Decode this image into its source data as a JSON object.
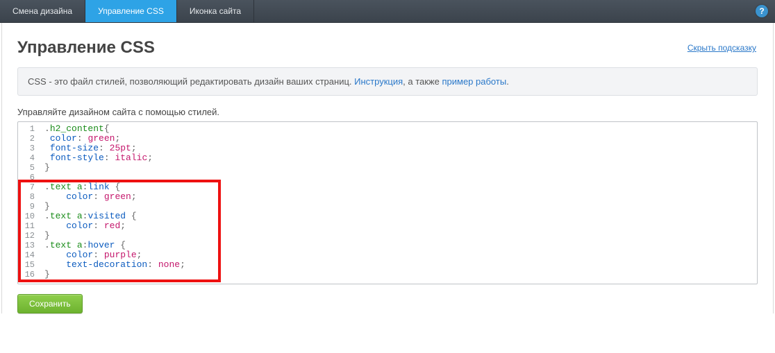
{
  "topbar": {
    "tabs": [
      {
        "label": "Смена дизайна",
        "active": false
      },
      {
        "label": "Управление CSS",
        "active": true
      },
      {
        "label": "Иконка сайта",
        "active": false
      }
    ],
    "help_glyph": "?"
  },
  "header": {
    "title": "Управление CSS",
    "hide_hint": "Скрыть подсказку"
  },
  "hint": {
    "prefix": "CSS - это файл стилей, позволяющий редактировать дизайн ваших страниц. ",
    "link1": "Инструкция",
    "mid": ", а также ",
    "link2": "пример работы",
    "suffix": "."
  },
  "subhead": "Управляйте дизайном сайта с помощью стилей.",
  "code_lines": [
    {
      "n": 1,
      "raw": ".h2_content{",
      "tokens": [
        {
          "t": "punc",
          "v": "."
        },
        {
          "t": "ident",
          "v": "h2_content"
        },
        {
          "t": "punc",
          "v": "{"
        }
      ]
    },
    {
      "n": 2,
      "raw": "color: green;",
      "indent": " ",
      "tokens": [
        {
          "t": "prop",
          "v": "color"
        },
        {
          "t": "punc",
          "v": ": "
        },
        {
          "t": "val",
          "v": "green"
        },
        {
          "t": "punc",
          "v": ";"
        }
      ]
    },
    {
      "n": 3,
      "raw": "font-size: 25pt;",
      "indent": " ",
      "tokens": [
        {
          "t": "prop",
          "v": "font-size"
        },
        {
          "t": "punc",
          "v": ": "
        },
        {
          "t": "num",
          "v": "25pt"
        },
        {
          "t": "punc",
          "v": ";"
        }
      ]
    },
    {
      "n": 4,
      "raw": "font-style: italic;",
      "indent": " ",
      "tokens": [
        {
          "t": "prop",
          "v": "font-style"
        },
        {
          "t": "punc",
          "v": ": "
        },
        {
          "t": "val",
          "v": "italic"
        },
        {
          "t": "punc",
          "v": ";"
        }
      ]
    },
    {
      "n": 5,
      "raw": "}",
      "tokens": [
        {
          "t": "punc",
          "v": "}"
        }
      ]
    },
    {
      "n": 6,
      "raw": "",
      "tokens": []
    },
    {
      "n": 7,
      "raw": ".text a:link {",
      "tokens": [
        {
          "t": "punc",
          "v": "."
        },
        {
          "t": "ident",
          "v": "text"
        },
        {
          "t": "punc",
          "v": " "
        },
        {
          "t": "sel",
          "v": "a"
        },
        {
          "t": "punc",
          "v": ":"
        },
        {
          "t": "pseudo",
          "v": "link"
        },
        {
          "t": "punc",
          "v": " {"
        }
      ]
    },
    {
      "n": 8,
      "raw": "    color: green;",
      "indent": "    ",
      "tokens": [
        {
          "t": "prop",
          "v": "color"
        },
        {
          "t": "punc",
          "v": ": "
        },
        {
          "t": "val",
          "v": "green"
        },
        {
          "t": "punc",
          "v": ";"
        }
      ]
    },
    {
      "n": 9,
      "raw": "}",
      "tokens": [
        {
          "t": "punc",
          "v": "}"
        }
      ]
    },
    {
      "n": 10,
      "raw": ".text a:visited {",
      "tokens": [
        {
          "t": "punc",
          "v": "."
        },
        {
          "t": "ident",
          "v": "text"
        },
        {
          "t": "punc",
          "v": " "
        },
        {
          "t": "sel",
          "v": "a"
        },
        {
          "t": "punc",
          "v": ":"
        },
        {
          "t": "pseudo",
          "v": "visited"
        },
        {
          "t": "punc",
          "v": " {"
        }
      ]
    },
    {
      "n": 11,
      "raw": "    color: red;",
      "indent": "    ",
      "tokens": [
        {
          "t": "prop",
          "v": "color"
        },
        {
          "t": "punc",
          "v": ": "
        },
        {
          "t": "val",
          "v": "red"
        },
        {
          "t": "punc",
          "v": ";"
        }
      ]
    },
    {
      "n": 12,
      "raw": "}",
      "tokens": [
        {
          "t": "punc",
          "v": "}"
        }
      ]
    },
    {
      "n": 13,
      "raw": ".text a:hover {",
      "tokens": [
        {
          "t": "punc",
          "v": "."
        },
        {
          "t": "ident",
          "v": "text"
        },
        {
          "t": "punc",
          "v": " "
        },
        {
          "t": "sel",
          "v": "a"
        },
        {
          "t": "punc",
          "v": ":"
        },
        {
          "t": "pseudo",
          "v": "hover"
        },
        {
          "t": "punc",
          "v": " {"
        }
      ]
    },
    {
      "n": 14,
      "raw": "    color: purple;",
      "indent": "    ",
      "tokens": [
        {
          "t": "prop",
          "v": "color"
        },
        {
          "t": "punc",
          "v": ": "
        },
        {
          "t": "val",
          "v": "purple"
        },
        {
          "t": "punc",
          "v": ";"
        }
      ]
    },
    {
      "n": 15,
      "raw": "    text-decoration: none;",
      "indent": "    ",
      "tokens": [
        {
          "t": "prop",
          "v": "text-decoration"
        },
        {
          "t": "punc",
          "v": ": "
        },
        {
          "t": "val",
          "v": "none"
        },
        {
          "t": "punc",
          "v": ";"
        }
      ]
    },
    {
      "n": 16,
      "raw": "}",
      "tokens": [
        {
          "t": "punc",
          "v": "}"
        }
      ]
    }
  ],
  "highlight": {
    "from_line": 7,
    "to_line": 16
  },
  "buttons": {
    "save": "Сохранить"
  }
}
